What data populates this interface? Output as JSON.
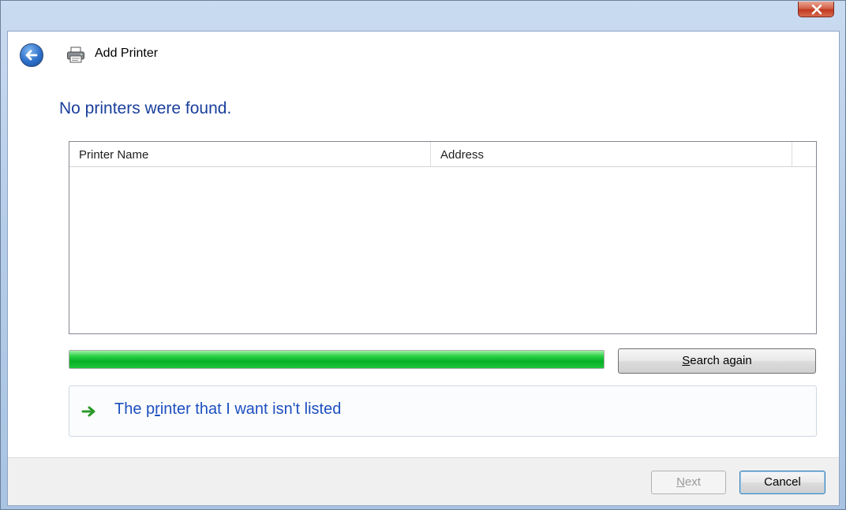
{
  "window": {
    "close_label": "Close"
  },
  "header": {
    "back_label": "Back",
    "title": "Add Printer"
  },
  "main": {
    "heading": "No printers were found.",
    "list": {
      "columns": [
        "Printer Name",
        "Address"
      ],
      "rows": []
    },
    "progress": {
      "value": 1.0
    },
    "search_button": {
      "mnemonic": "S",
      "rest": "earch again"
    },
    "not_listed_link": {
      "before": "The p",
      "mnemonic": "r",
      "after": "inter that I want isn't listed"
    }
  },
  "footer": {
    "next_button": {
      "mnemonic": "N",
      "rest": "ext",
      "enabled": false
    },
    "cancel_button": "Cancel"
  },
  "colors": {
    "heading": "#1a3f9c",
    "link": "#1c4fc0",
    "progress_fill": "#06b025",
    "close_button": "#c0391f"
  }
}
